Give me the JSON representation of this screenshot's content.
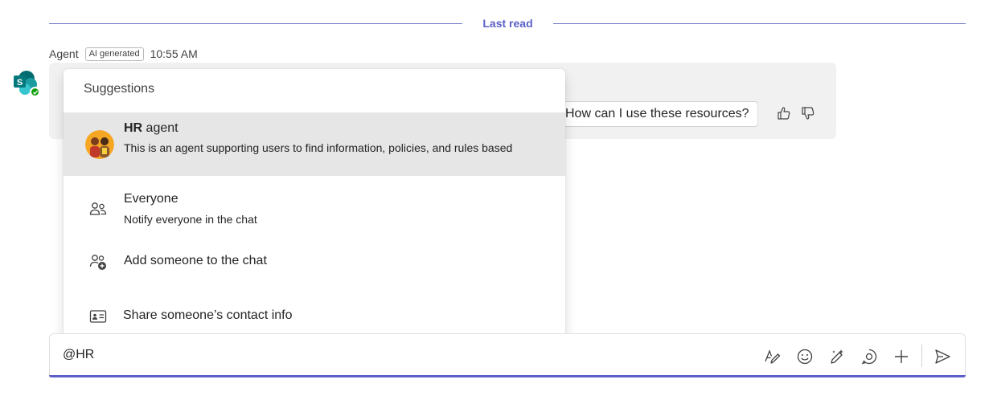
{
  "divider": {
    "label": "Last read"
  },
  "message": {
    "sender": "Agent",
    "badge": "AI generated",
    "time": "10:55 AM",
    "suggested_prompt": "How can I use these resources?",
    "avatar_icon": "sharepoint-icon",
    "presence": "available"
  },
  "suggestions": {
    "title": "Suggestions",
    "items": [
      {
        "name_bold": "HR",
        "name_rest": " agent",
        "description": "This is an agent supporting users to find information, policies, and rules based",
        "icon": "hr-agent-avatar",
        "selected": true
      },
      {
        "name": "Everyone",
        "description": "Notify everyone in the chat",
        "icon": "people-icon"
      },
      {
        "name": "Add someone to the chat",
        "icon": "person-add-icon"
      },
      {
        "name": "Share someone’s contact info",
        "icon": "contact-card-icon"
      }
    ]
  },
  "compose": {
    "value": "@HR",
    "tools": [
      "format-icon",
      "emoji-icon",
      "copilot-draw-icon",
      "loop-icon",
      "plus-icon",
      "send-icon"
    ]
  },
  "colors": {
    "accent": "#5b5fc7",
    "presence": "#13a10e",
    "selected_row": "#e6e6e6"
  }
}
